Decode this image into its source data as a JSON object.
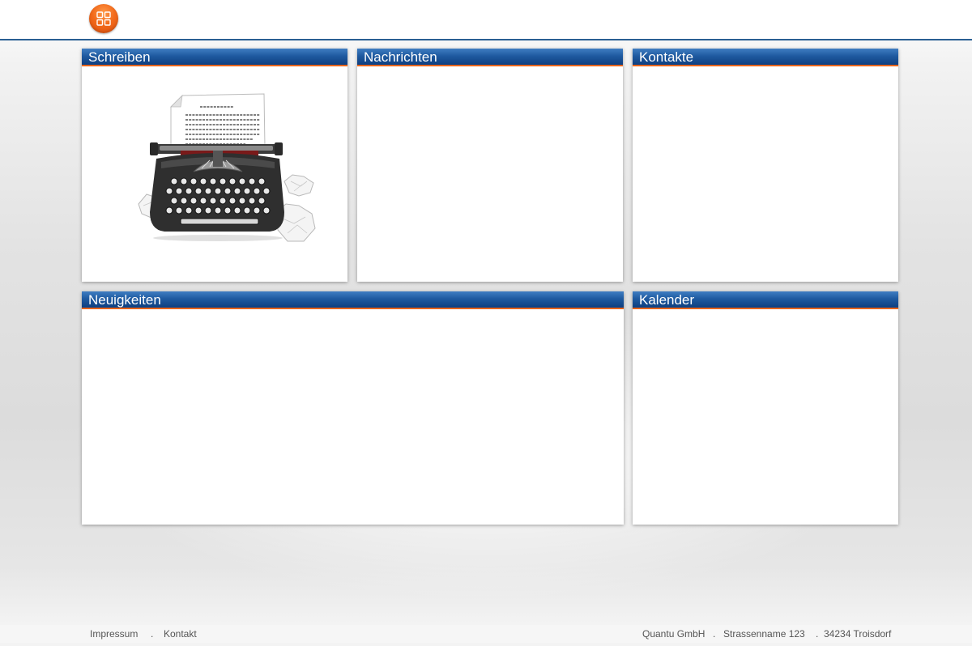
{
  "header": {
    "home_button_icon": "grid-icon",
    "accent_color": "#f26a1b",
    "border_color": "#2a5f93"
  },
  "panels": {
    "schreiben": {
      "title": "Schreiben",
      "image": "typewriter-illustration"
    },
    "nachrichten": {
      "title": "Nachrichten"
    },
    "kontakte": {
      "title": "Kontakte"
    },
    "neuigkeiten": {
      "title": "Neuigkeiten"
    },
    "kalender": {
      "title": "Kalender"
    }
  },
  "footer": {
    "links": [
      "Impressum",
      "Kontakt"
    ],
    "separator": ".",
    "company": "Quantu GmbH",
    "street": "Strassenname 123",
    "city": "34234 Troisdorf"
  },
  "colors": {
    "header_blue": "#1f5aa0",
    "header_orange_line": "#e8651c"
  }
}
